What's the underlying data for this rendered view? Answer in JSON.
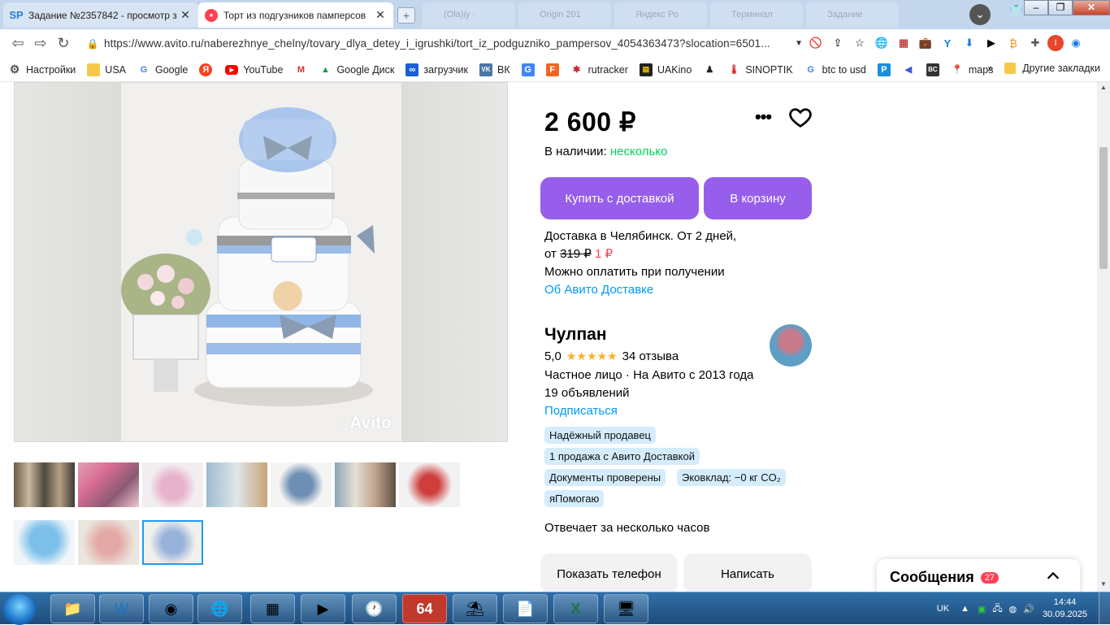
{
  "browser": {
    "tabs": [
      {
        "favicon": "SP",
        "title": "Задание №2357842 - просмотр з",
        "active": false
      },
      {
        "favicon": "●",
        "title": "Торт из подгузников памперсов",
        "active": true
      }
    ],
    "ghost_tabs": [
      "(Ola)iy · ",
      "Origin 201",
      "Яндекс Ро",
      "Терминал",
      "Задание"
    ],
    "url": "https://www.avito.ru/naberezhnye_chelny/tovary_dlya_detey_i_igrushki/tort_iz_podguzniko_pampersov_4054363473?slocation=6501...",
    "bookmarks": [
      {
        "label": "Настройки",
        "icon": "gear-icon"
      },
      {
        "label": "USA",
        "icon": "folder-icon"
      },
      {
        "label": "Google",
        "icon": "google-icon"
      },
      {
        "label": "",
        "icon": "yandex-icon"
      },
      {
        "label": "YouTube",
        "icon": "youtube-icon"
      },
      {
        "label": "",
        "icon": "gmail-icon"
      },
      {
        "label": "Google Диск",
        "icon": "drive-icon"
      },
      {
        "label": "загрузчик",
        "icon": "loop-icon"
      },
      {
        "label": "ВК",
        "icon": "vk-icon"
      },
      {
        "label": "",
        "icon": "translate-icon"
      },
      {
        "label": "",
        "icon": "f-icon"
      },
      {
        "label": "rutracker",
        "icon": "rutracker-icon"
      },
      {
        "label": "UAKino",
        "icon": "film-icon"
      },
      {
        "label": "",
        "icon": "figure-icon"
      },
      {
        "label": "SINOPTIK",
        "icon": "thermometer-icon"
      },
      {
        "label": "btc to usd",
        "icon": "google-icon"
      },
      {
        "label": "",
        "icon": "p-icon"
      },
      {
        "label": "",
        "icon": "arrow-icon"
      },
      {
        "label": "",
        "icon": "bc-icon"
      },
      {
        "label": "maps",
        "icon": "maps-icon"
      }
    ],
    "bookmarks_more": "»",
    "other_bookmarks": "Другие закладки"
  },
  "listing": {
    "watermark": "Avito",
    "price": "2 600 ₽",
    "availability_label": "В наличии:",
    "availability_value": "несколько",
    "buy_button": "Купить с доставкой",
    "cart_button": "В корзину",
    "delivery_line": "Доставка в Челябинск. От 2 дней,",
    "price_from": "от",
    "old_price": "319 ₽",
    "new_price": "1 ₽",
    "pay_on_receipt": "Можно оплатить при получении",
    "about_delivery": "Об Авито Доставке"
  },
  "seller": {
    "name": "Чулпан",
    "rating": "5,0",
    "stars": "★★★★★",
    "reviews": "34 отзыва",
    "type_line": "Частное лицо · На Авито с 2013 года",
    "ads": "19 объявлений",
    "subscribe": "Подписаться",
    "badges": [
      "Надёжный продавец",
      "1 продажа с Авито Доставкой",
      "Документы проверены",
      "Эковклад: −0 кг CO₂",
      "яПомогаю"
    ],
    "reply_time": "Отвечает за несколько часов",
    "phone_button": "Показать телефон",
    "write_button": "Написать"
  },
  "messages": {
    "label": "Сообщения",
    "count": "27"
  },
  "taskbar": {
    "lang": "UK",
    "time": "14:44",
    "date": "30.09.2025"
  },
  "colors": {
    "accent_purple": "#965eeb",
    "green": "#02d15c",
    "link_blue": "#0099f7",
    "badge_bg": "#d4ecfb",
    "red": "#ff4053"
  }
}
